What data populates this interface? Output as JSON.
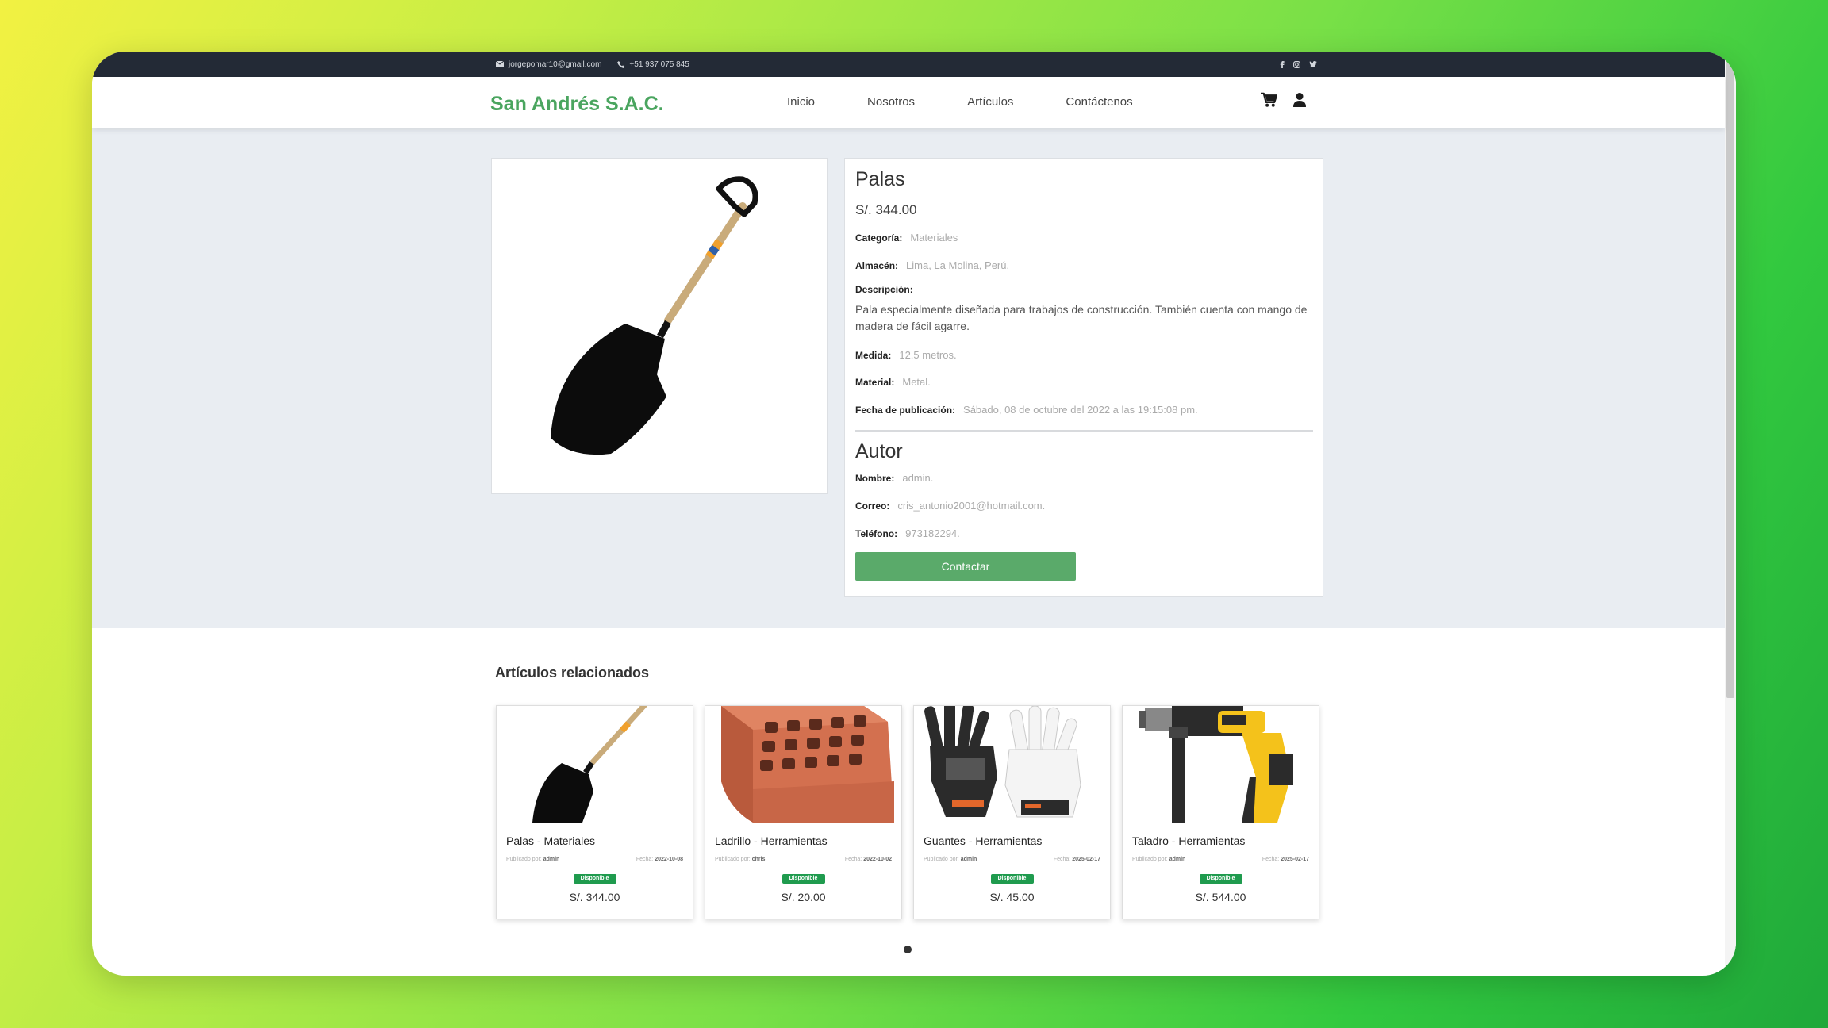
{
  "topbar": {
    "email": "jorgepomar10@gmail.com",
    "phone": "+51 937 075 845",
    "socials": [
      "facebook-icon",
      "instagram-icon",
      "twitter-icon"
    ]
  },
  "navbar": {
    "brand": "San Andrés S.A.C.",
    "links": [
      "Inicio",
      "Nosotros",
      "Artículos",
      "Contáctenos"
    ],
    "icons": [
      "cart-icon",
      "user-icon"
    ]
  },
  "product": {
    "name": "Palas",
    "price": "S/. 344.00",
    "category_label": "Categoría:",
    "category": "Materiales",
    "warehouse_label": "Almacén:",
    "warehouse": "Lima, La Molina, Perú.",
    "description_label": "Descripción:",
    "description": "Pala especialmente diseñada para trabajos de construcción. También cuenta con mango de madera de fácil agarre.",
    "size_label": "Medida:",
    "size": "12.5 metros.",
    "material_label": "Material:",
    "material": "Metal.",
    "date_label": "Fecha de publicación:",
    "date": "Sábado, 08 de octubre del 2022 a las 19:15:08 pm."
  },
  "author": {
    "heading": "Autor",
    "name_label": "Nombre:",
    "name": "admin.",
    "email_label": "Correo:",
    "email": "cris_antonio2001@hotmail.com.",
    "phone_label": "Teléfono:",
    "phone": "973182294.",
    "contact_button": "Contactar"
  },
  "related": {
    "title": "Artículos relacionados",
    "items": [
      {
        "title": "Palas - Materiales",
        "by_label": "Publicado por:",
        "by": "admin",
        "date_label": "Fecha:",
        "date": "2022-10-08",
        "status": "Disponible",
        "price": "S/. 344.00"
      },
      {
        "title": "Ladrillo - Herramientas",
        "by_label": "Publicado por:",
        "by": "chris",
        "date_label": "Fecha:",
        "date": "2022-10-02",
        "status": "Disponible",
        "price": "S/. 20.00"
      },
      {
        "title": "Guantes - Herramientas",
        "by_label": "Publicado por:",
        "by": "admin",
        "date_label": "Fecha:",
        "date": "2025-02-17",
        "status": "Disponible",
        "price": "S/. 45.00"
      },
      {
        "title": "Taladro - Herramientas",
        "by_label": "Publicado por:",
        "by": "admin",
        "date_label": "Fecha:",
        "date": "2025-02-17",
        "status": "Disponible",
        "price": "S/. 544.00"
      }
    ]
  },
  "colors": {
    "brand": "#4aa55f",
    "topbar": "#232a36",
    "badge": "#1f9b4e",
    "button": "#5aaa6a",
    "section_bg": "#e9edf2"
  }
}
